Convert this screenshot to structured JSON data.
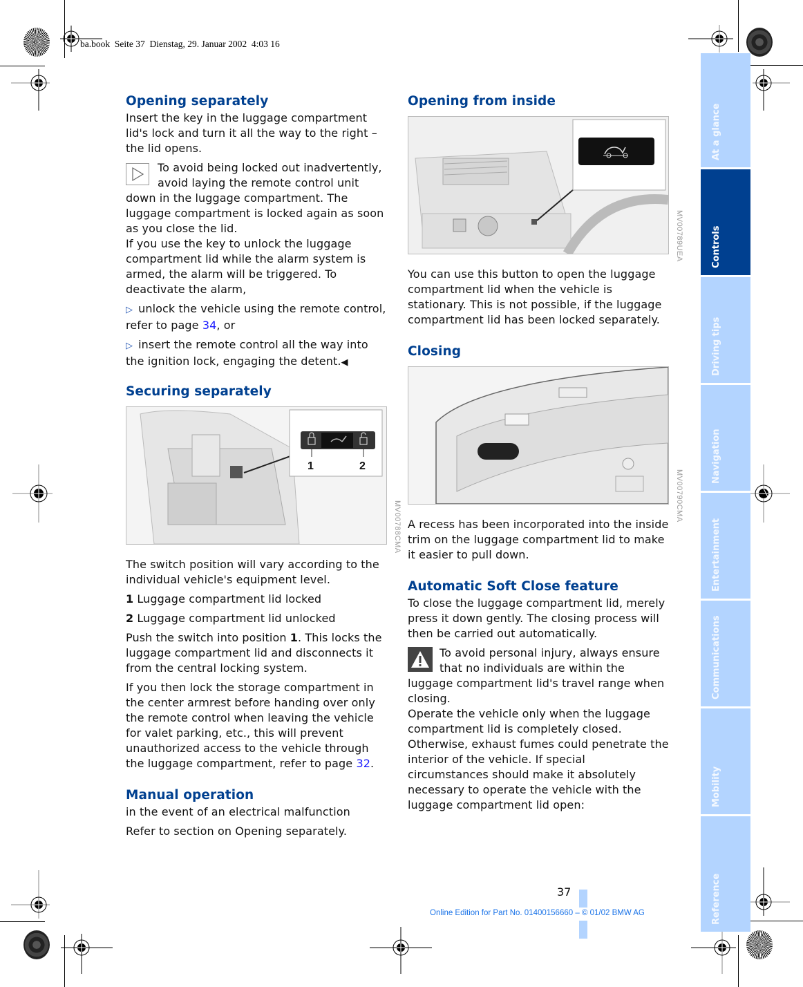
{
  "print_stamp": "ba.book  Seite 37  Dienstag, 29. Januar 2002  4:03 16",
  "left_column": {
    "opening_separately": {
      "heading": "Opening separately",
      "text": "Insert the key in the luggage compartment lid's lock and turn it all the way to the right – the lid opens.",
      "note_icon": "triangle-right-icon",
      "note_text": "To avoid being locked out inadvertently, avoid laying the remote control unit down in the luggage compartment. The luggage compartment is locked again as soon as you close the lid.",
      "alarm_text": "If you use the key to unlock the luggage compartment lid while the alarm system is armed, the alarm will be triggered. To deactivate the alarm,",
      "bullets": [
        {
          "before": "unlock the vehicle using the remote control, refer to page ",
          "link": "34",
          "after": ", or"
        },
        {
          "before": "insert the remote control all the way into the ignition lock, engaging the detent.",
          "link": "",
          "after": ""
        }
      ],
      "end_mark": "◀"
    },
    "securing_separately": {
      "heading": "Securing separately",
      "figure_code": "MV00788CMA",
      "callouts": [
        "1",
        "2"
      ],
      "text1": "The switch position will vary according to the individual vehicle's equipment level.",
      "legend": [
        {
          "num": "1",
          "label": "Luggage compartment lid locked"
        },
        {
          "num": "2",
          "label": "Luggage compartment lid unlocked"
        }
      ],
      "push_before": "Push the switch into position ",
      "push_bold": "1",
      "push_after": ". This locks the luggage compartment lid and disconnects it from the central locking system.",
      "valet_before": "If you then lock the storage compartment in the center armrest before handing over only the remote control when leaving the vehicle for valet parking, etc., this will prevent unauthorized access to the vehicle through the luggage compartment, refer to page ",
      "valet_link": "32",
      "valet_after": "."
    },
    "manual_operation": {
      "heading": "Manual operation",
      "text1": "in the event of an electrical malfunction",
      "text2": "Refer to section on Opening separately."
    }
  },
  "right_column": {
    "opening_from_inside": {
      "heading": "Opening from inside",
      "figure_code": "MV00789UEA",
      "text": "You can use this button to open the luggage compartment lid when the vehicle is stationary. This is not possible, if the luggage compartment lid has been locked separately."
    },
    "closing": {
      "heading": "Closing",
      "figure_code": "MV00790CMA",
      "text": "A recess has been incorporated into the inside trim on the luggage compartment lid to make it easier to pull down."
    },
    "soft_close": {
      "heading": "Automatic Soft Close feature",
      "text": "To close the luggage compartment lid, merely press it down gently. The closing process will then be carried out automatically.",
      "warning_icon": "warning-triangle-icon",
      "warning_text": "To avoid personal injury, always ensure that no individuals are within the luggage compartment lid's travel range when closing.",
      "warning_text2": "Operate the vehicle only when the luggage compartment lid is completely closed. Otherwise, exhaust fumes could penetrate the interior of the vehicle. If special circumstances should make it absolutely necessary to operate the vehicle with the luggage compartment lid open:"
    }
  },
  "thumb_tabs": [
    {
      "label": "At a glance",
      "active": false
    },
    {
      "label": "Controls",
      "active": true
    },
    {
      "label": "Driving tips",
      "active": false
    },
    {
      "label": "Navigation",
      "active": false
    },
    {
      "label": "Entertainment",
      "active": false
    },
    {
      "label": "Communications",
      "active": false
    },
    {
      "label": "Mobility",
      "active": false
    },
    {
      "label": "Reference",
      "active": false
    }
  ],
  "footer": {
    "page_number": "37",
    "edition": "Online Edition for Part No. 01400156660 – © 01/02 BMW AG"
  },
  "colors": {
    "heading": "#004090",
    "tab_active": "#004090",
    "tab_inactive": "#b3d4ff",
    "link": "#1a1aff",
    "footer_text": "#1a73e8"
  }
}
